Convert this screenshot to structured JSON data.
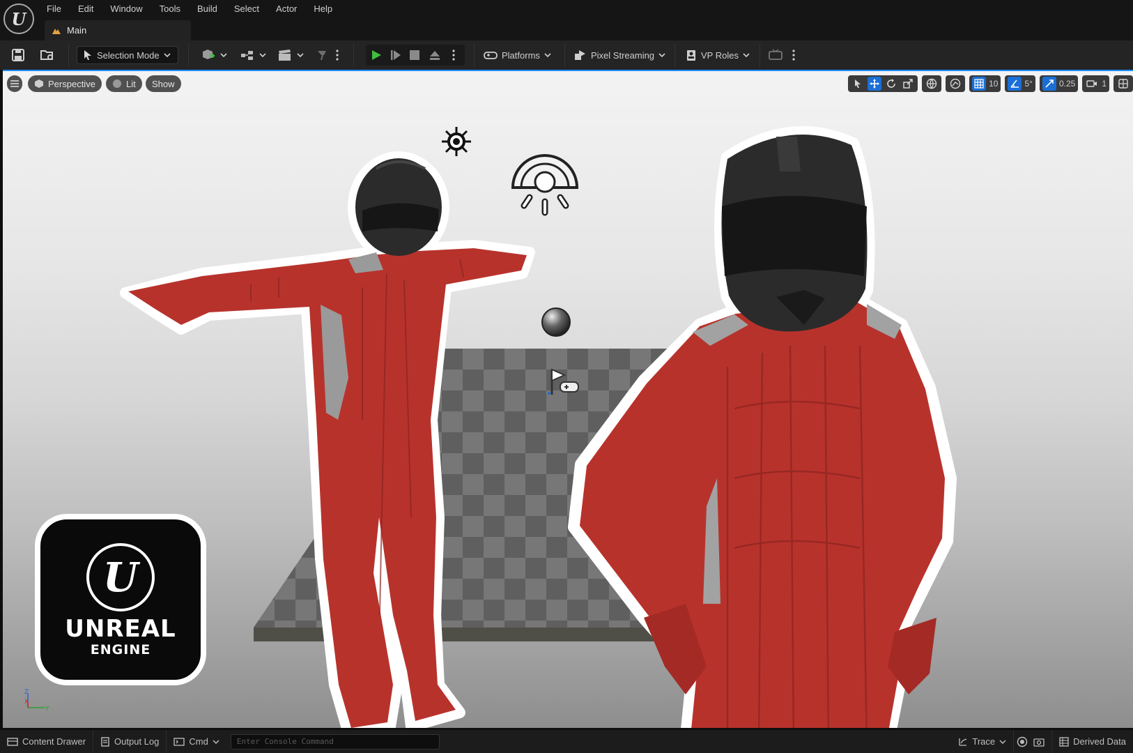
{
  "menubar": {
    "items": [
      "File",
      "Edit",
      "Window",
      "Tools",
      "Build",
      "Select",
      "Actor",
      "Help"
    ],
    "tab": "Main"
  },
  "toolbar": {
    "selection_mode": "Selection Mode",
    "platforms": "Platforms",
    "pixel_streaming": "Pixel Streaming",
    "vp_roles": "VP Roles"
  },
  "viewport": {
    "perspective": "Perspective",
    "lit": "Lit",
    "show": "Show",
    "grid_snap": "10",
    "rotation_snap": "5°",
    "scale_snap": "0.25",
    "camera_speed": "1",
    "axis_z": "Z",
    "axis_x": "X",
    "axis_y": "Y"
  },
  "badge": {
    "logo_mark": "U",
    "title": "UNREAL",
    "subtitle": "ENGINE"
  },
  "statusbar": {
    "content_drawer": "Content Drawer",
    "output_log": "Output Log",
    "cmd": "Cmd",
    "console_placeholder": "Enter Console Command",
    "trace": "Trace",
    "derived_data": "Derived Data"
  },
  "colors": {
    "accent": "#1a6fd6",
    "play_green": "#3fbf3f",
    "suit_red": "#b8322c",
    "helmet": "#2a2a2a"
  }
}
